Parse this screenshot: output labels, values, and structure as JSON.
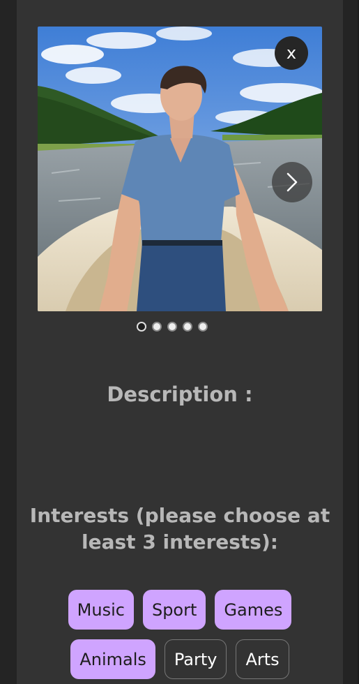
{
  "profile": {
    "close_label": "x",
    "photo_icon": "person-photo",
    "next_icon": "chevron-right-icon",
    "carousel": {
      "count": 5,
      "active_index": 0
    }
  },
  "description": {
    "title": "Description :"
  },
  "interests": {
    "title": "Interests (please choose at least 3 interests):",
    "rows": [
      [
        {
          "label": "Music",
          "selected": true
        },
        {
          "label": "Sport",
          "selected": true
        },
        {
          "label": "Games",
          "selected": true
        }
      ],
      [
        {
          "label": "Animals",
          "selected": true
        },
        {
          "label": "Party",
          "selected": false
        },
        {
          "label": "Arts",
          "selected": false
        }
      ]
    ]
  },
  "colors": {
    "tag_selected": "#cfa4ff",
    "panel": "#333333",
    "text_muted": "#b8b8b8"
  }
}
